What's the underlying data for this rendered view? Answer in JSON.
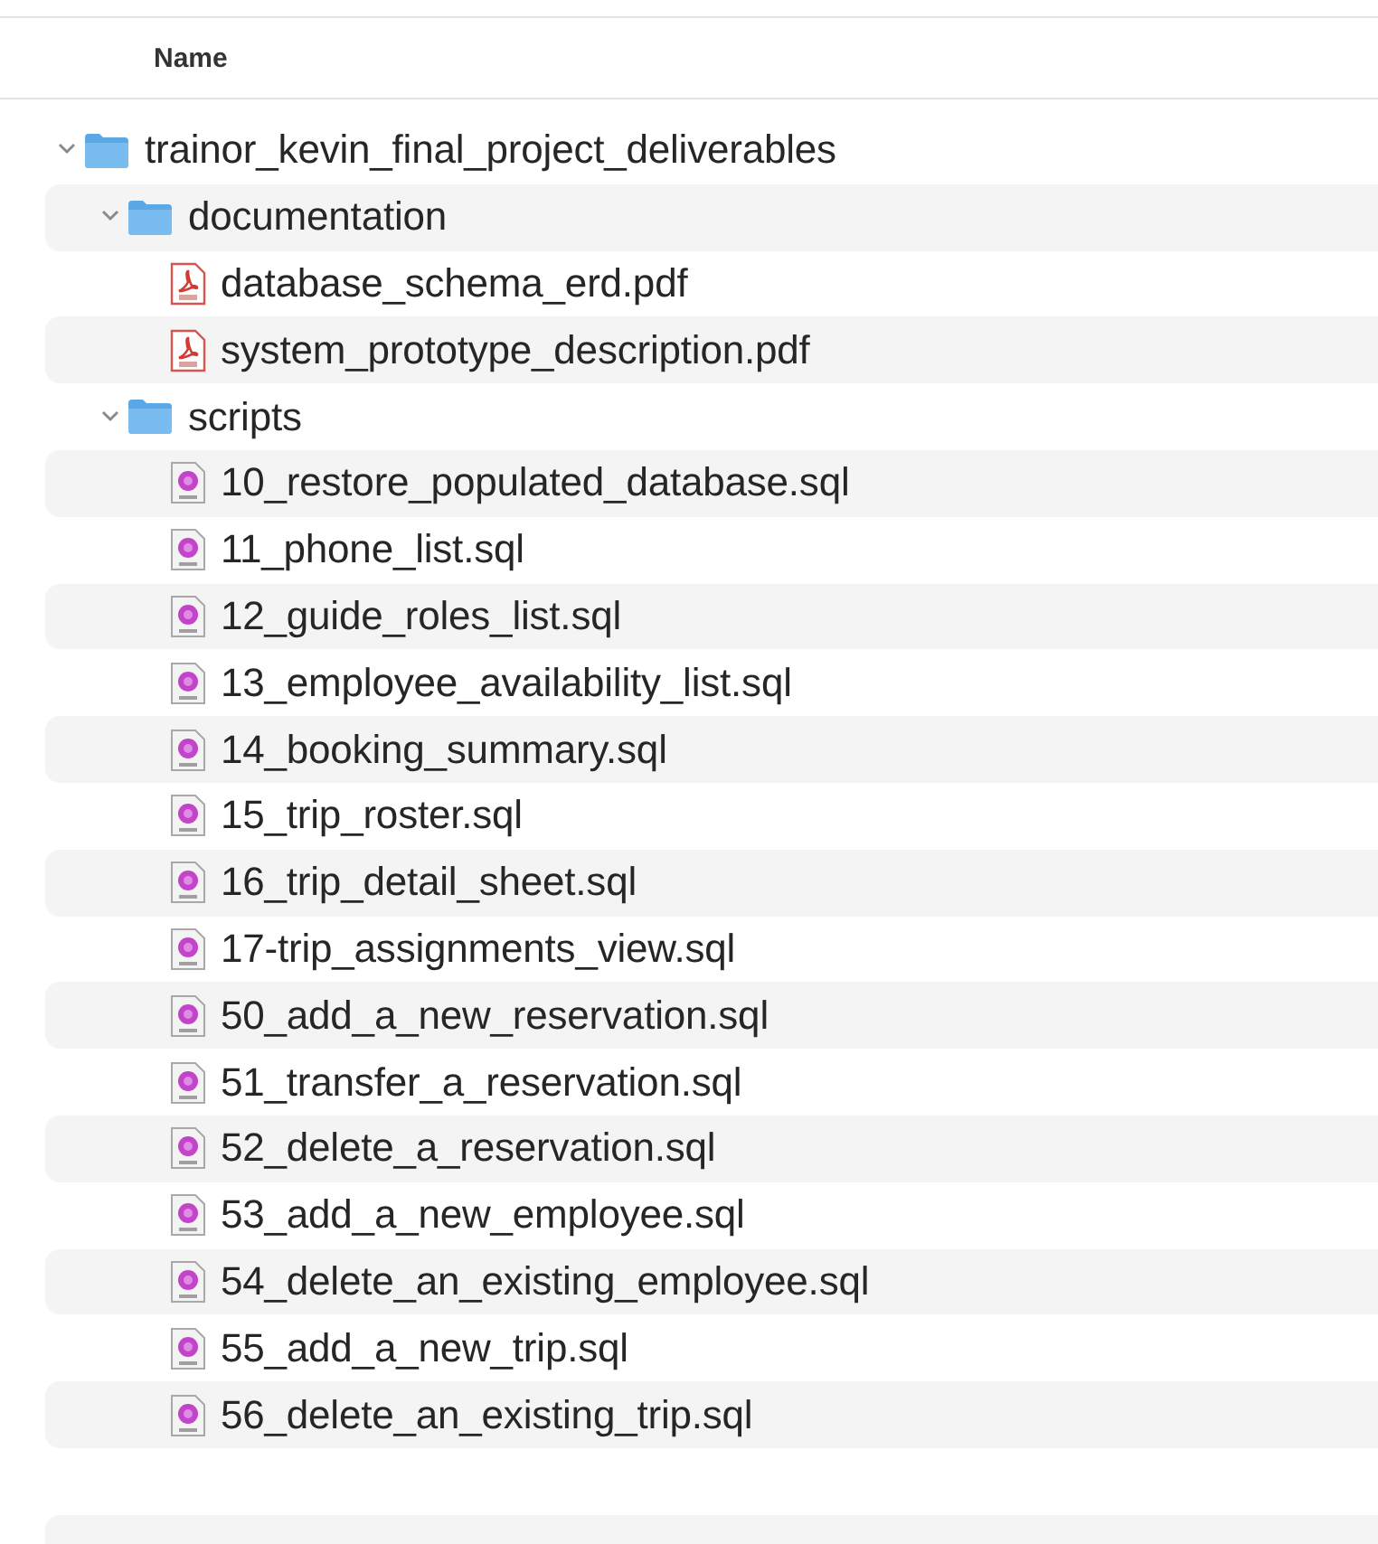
{
  "columns": [
    {
      "label": "Name"
    }
  ],
  "tree": [
    {
      "name": "trainor_kevin_final_project_deliverables",
      "kind": "folder",
      "expanded": true,
      "children": [
        {
          "name": "documentation",
          "kind": "folder",
          "expanded": true,
          "children": [
            {
              "name": "database_schema_erd.pdf",
              "kind": "pdf"
            },
            {
              "name": "system_prototype_description.pdf",
              "kind": "pdf"
            }
          ]
        },
        {
          "name": "scripts",
          "kind": "folder",
          "expanded": true,
          "children": [
            {
              "name": "10_restore_populated_database.sql",
              "kind": "sql"
            },
            {
              "name": "11_phone_list.sql",
              "kind": "sql"
            },
            {
              "name": "12_guide_roles_list.sql",
              "kind": "sql"
            },
            {
              "name": "13_employee_availability_list.sql",
              "kind": "sql"
            },
            {
              "name": "14_booking_summary.sql",
              "kind": "sql"
            },
            {
              "name": "15_trip_roster.sql",
              "kind": "sql"
            },
            {
              "name": "16_trip_detail_sheet.sql",
              "kind": "sql"
            },
            {
              "name": "17-trip_assignments_view.sql",
              "kind": "sql"
            },
            {
              "name": "50_add_a_new_reservation.sql",
              "kind": "sql"
            },
            {
              "name": "51_transfer_a_reservation.sql",
              "kind": "sql"
            },
            {
              "name": "52_delete_a_reservation.sql",
              "kind": "sql"
            },
            {
              "name": "53_add_a_new_employee.sql",
              "kind": "sql"
            },
            {
              "name": "54_delete_an_existing_employee.sql",
              "kind": "sql"
            },
            {
              "name": "55_add_a_new_trip.sql",
              "kind": "sql"
            },
            {
              "name": "56_delete_an_existing_trip.sql",
              "kind": "sql"
            }
          ]
        }
      ]
    }
  ]
}
